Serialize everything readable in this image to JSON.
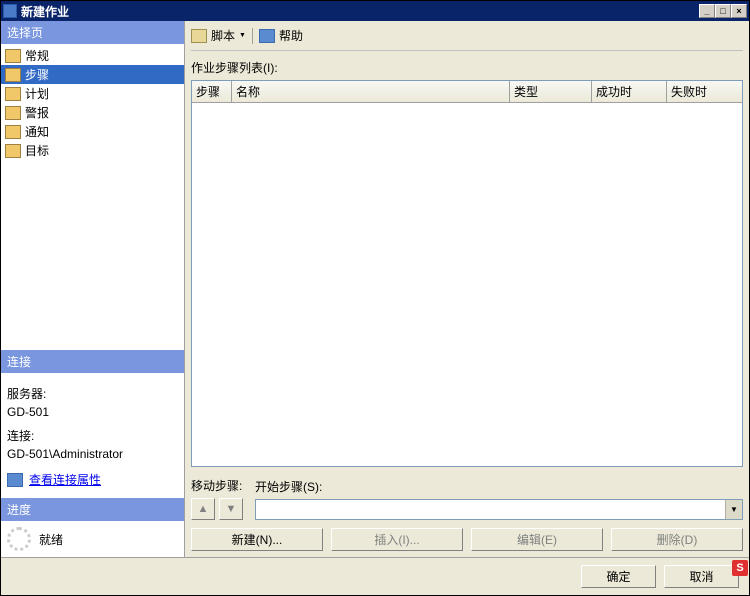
{
  "window": {
    "title": "新建作业"
  },
  "leftPanel": {
    "selectHeader": "选择页",
    "navItems": [
      "常规",
      "步骤",
      "计划",
      "警报",
      "通知",
      "目标"
    ],
    "selectedIndex": 1,
    "connHeader": "连接",
    "serverLabel": "服务器:",
    "serverValue": "GD-501",
    "connLabel": "连接:",
    "connValue": "GD-501\\Administrator",
    "viewConnLink": "查看连接属性",
    "progressHeader": "进度",
    "progressStatus": "就绪"
  },
  "toolbar": {
    "script": "脚本",
    "help": "帮助"
  },
  "content": {
    "listLabel": "作业步骤列表(I):",
    "columns": {
      "c1": "步骤",
      "c2": "名称",
      "c3": "类型",
      "c4": "成功时",
      "c5": "失败时"
    },
    "moveLabel": "移动步骤:",
    "startLabel": "开始步骤(S):",
    "buttons": {
      "new": "新建(N)...",
      "insert": "插入(I)...",
      "edit": "编辑(E)",
      "delete": "删除(D)"
    }
  },
  "dialog": {
    "ok": "确定",
    "cancel": "取消"
  },
  "badge": "S"
}
